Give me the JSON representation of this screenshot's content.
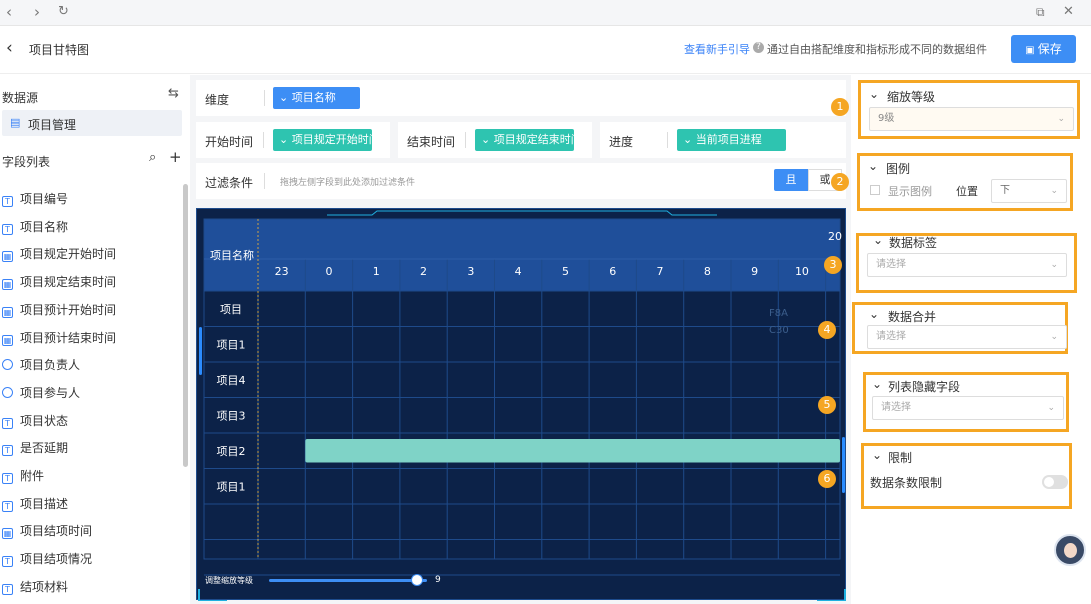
{
  "header": {
    "title": "项目甘特图",
    "guide_link": "查看新手引导",
    "guide_desc": "通过自由搭配维度和指标形成不同的数据组件",
    "save_label": "保存"
  },
  "left": {
    "datasource_label": "数据源",
    "datasource_item": "项目管理",
    "fields_label": "字段列表",
    "fields": [
      "项目编号",
      "项目名称",
      "项目规定开始时间",
      "项目规定结束时间",
      "项目预计开始时间",
      "项目预计结束时间",
      "项目负责人",
      "项目参与人",
      "项目状态",
      "是否延期",
      "附件",
      "项目描述",
      "项目结项时间",
      "项目结项情况",
      "结项材料"
    ]
  },
  "config": {
    "dimension_label": "维度",
    "dimension_value": "项目名称",
    "start_label": "开始时间",
    "start_value": "项目规定开始时间",
    "end_label": "结束时间",
    "end_value": "项目规定结束时间",
    "progress_label": "进度",
    "progress_value": "当前项目进程",
    "filter_label": "过滤条件",
    "filter_hint": "拖拽左侧字段到此处添加过滤条件",
    "and_label": "且",
    "or_label": "或"
  },
  "badges": [
    "1",
    "2",
    "3",
    "4",
    "5",
    "6"
  ],
  "gantt": {
    "header_label": "项目名称",
    "top_label": "20",
    "hours": [
      "23",
      "0",
      "1",
      "2",
      "3",
      "4",
      "5",
      "6",
      "7",
      "8",
      "9",
      "10"
    ],
    "rows": [
      "项目",
      "项目1",
      "项目4",
      "项目3",
      "项目2",
      "项目1"
    ],
    "faint": [
      "F8A",
      "C30"
    ],
    "bar": {
      "row": 4,
      "start_col": 1
    },
    "zoom_label": "调整缩放等级",
    "zoom_value": "9",
    "zoom_fraction": 0.9
  },
  "right": {
    "zoom": {
      "title": "缩放等级",
      "value": "9级"
    },
    "legend": {
      "title": "图例",
      "show_label": "显示图例",
      "pos_label": "位置",
      "pos_value": "下"
    },
    "data_label": {
      "title": "数据标签",
      "placeholder": "请选择"
    },
    "merge": {
      "title": "数据合并",
      "placeholder": "请选择"
    },
    "hidden": {
      "title": "列表隐藏字段",
      "placeholder": "请选择"
    },
    "limit": {
      "title": "限制",
      "item": "数据条数限制"
    }
  },
  "colors": {
    "accent": "#3d8ef5",
    "teal": "#2ec4b0",
    "highlight": "#f5a623",
    "gantt_bg": "#0c2248",
    "bar": "#7fd3c7"
  }
}
